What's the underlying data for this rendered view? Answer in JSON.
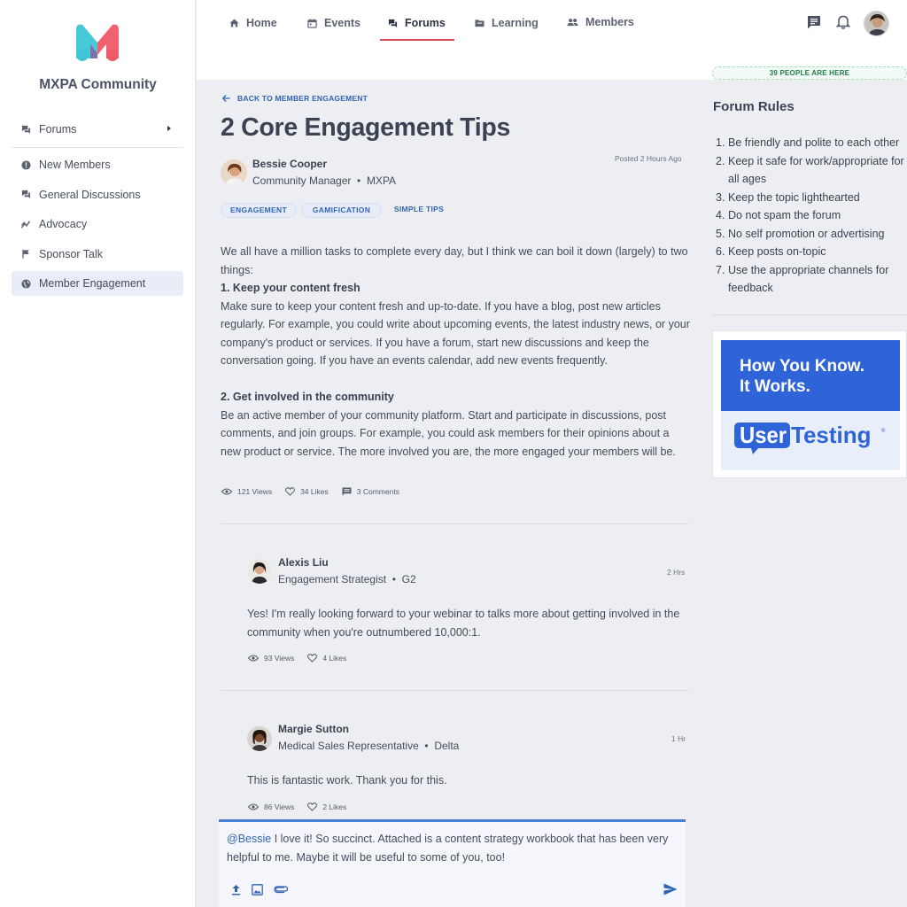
{
  "app": {
    "name": "MXPA Community"
  },
  "sidebar": {
    "items": [
      {
        "label": "Forums",
        "icon": "forum-icon"
      },
      {
        "label": "New Members",
        "icon": "alert-circle-icon"
      },
      {
        "label": "General Discussions",
        "icon": "forum-icon"
      },
      {
        "label": "Advocacy",
        "icon": "trend-icon"
      },
      {
        "label": "Sponsor Talk",
        "icon": "flag-icon"
      },
      {
        "label": "Member Engagement",
        "icon": "globe-icon"
      }
    ],
    "active": "Member Engagement"
  },
  "topnav": {
    "tabs": [
      {
        "label": "Home",
        "icon": "home-icon"
      },
      {
        "label": "Events",
        "icon": "calendar-icon"
      },
      {
        "label": "Forums",
        "icon": "forum-icon"
      },
      {
        "label": "Learning",
        "icon": "folder-icon"
      },
      {
        "label": "Members",
        "icon": "people-icon"
      }
    ],
    "active": "Forums"
  },
  "presence": "39 PEOPLE ARE HERE",
  "post": {
    "back_label": "BACK TO MEMBER ENGAGEMENT",
    "title": "2 Core Engagement Tips",
    "author": {
      "name": "Bessie Cooper",
      "role": "Community Manager",
      "org": "MXPA"
    },
    "posted": "Posted 2 Hours Ago",
    "tags": [
      "ENGAGEMENT",
      "GAMIFICATION",
      "SIMPLE TIPS"
    ],
    "body": {
      "intro": "We all have a million tasks to complete every day, but I think we can boil it down (largely) to two things:",
      "heading1": "1. Keep your content fresh",
      "para1": "Make sure to keep your content fresh and up-to-date. If you have a blog, post new articles regularly. For example, you could write about upcoming events, the latest industry news, or your company's product or services. If you have a forum, start new discussions and keep the conversation going. If you have an events calendar, add new events frequently.",
      "heading2": "2. Get involved in the community",
      "para2": "Be an active member of your community platform. Start and participate in discussions, post comments, and join groups. For example, you could ask members for their opinions about a new product or service. The more involved you are, the more engaged your members will be."
    },
    "stats": {
      "views": "121 Views",
      "likes": "34 Likes",
      "comments": "3 Comments"
    }
  },
  "replies": [
    {
      "name": "Alexis Liu",
      "role": "Engagement Strategist",
      "org": "G2",
      "time": "2 Hrs",
      "text": "Yes! I'm really looking forward to your webinar to talks more about getting involved in the community when you're outnumbered 10,000:1.",
      "views": "93 Views",
      "likes": "4 Likes"
    },
    {
      "name": "Margie Sutton",
      "role": "Medical Sales Representative",
      "org": "Delta",
      "time": "1 Hr",
      "text": "This is fantastic work. Thank you for this.",
      "views": "86 Views",
      "likes": "2 Likes"
    }
  ],
  "composer": {
    "mention": "@Bessie",
    "text": " I love it! So succinct.  Attached is a content strategy workbook that has been very helpful to me. Maybe it will be useful to some of you, too!"
  },
  "forum_rules": {
    "title": "Forum Rules",
    "items": [
      "Be friendly and polite to each other",
      "Keep it safe for work/appropriate for all ages",
      "Keep the topic lighthearted",
      "Do not spam the forum",
      "No self promotion or advertising",
      "Keep posts on-topic",
      "Use the appropriate channels for feedback"
    ]
  },
  "ad": {
    "headline": "How You Know.\nIt Works.",
    "brand": "UserTesting"
  },
  "colors": {
    "accent": "#3164b3",
    "tab_underline": "#e0475a",
    "presence_green": "#1f7a45",
    "ad_blue": "#2f63d8",
    "logo_cyan": "#3ec6d4",
    "logo_red": "#ef5a67"
  }
}
